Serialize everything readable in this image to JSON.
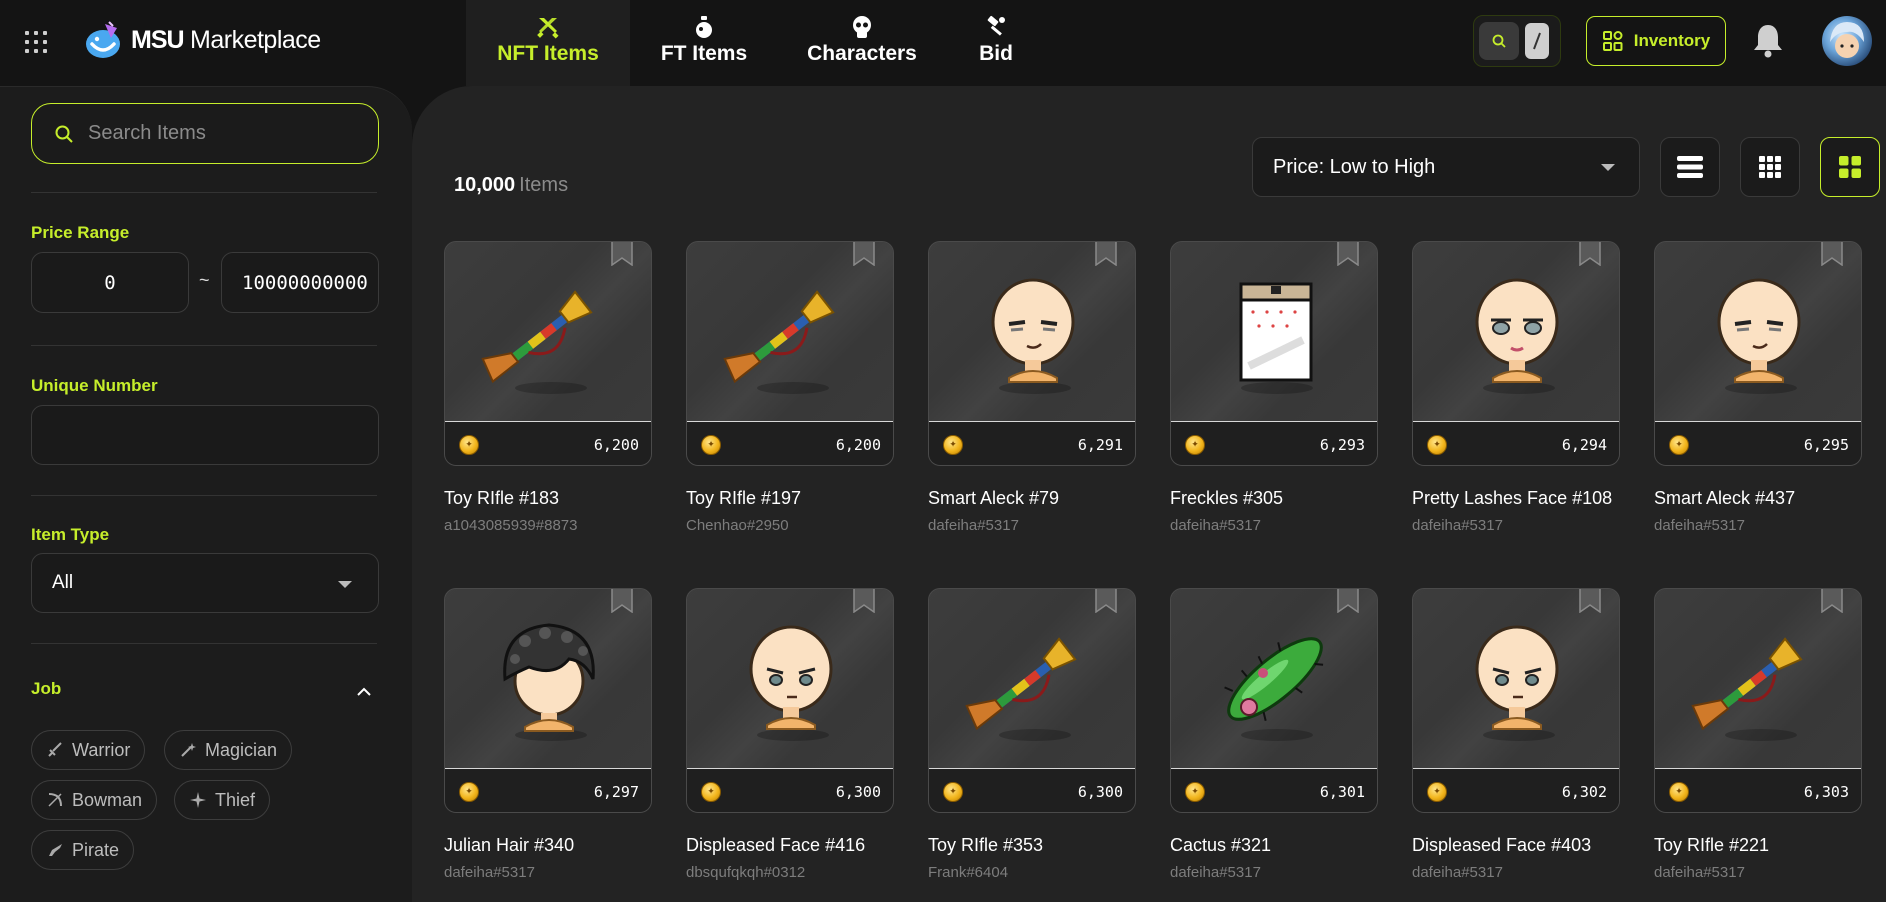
{
  "app": {
    "brand_bold": "MSU",
    "brand_rest": " Marketplace"
  },
  "nav": {
    "tabs": [
      {
        "label": "NFT Items",
        "icon": "sword-icon",
        "active": true
      },
      {
        "label": "FT Items",
        "icon": "potion-icon",
        "active": false
      },
      {
        "label": "Characters",
        "icon": "skull-icon",
        "active": false
      },
      {
        "label": "Bid",
        "icon": "gavel-icon",
        "active": false
      }
    ]
  },
  "header": {
    "inventory_label": "Inventory"
  },
  "sidebar": {
    "search_placeholder": "Search Items",
    "price_range_label": "Price Range",
    "price_min": "0",
    "price_max": "10000000000",
    "price_sep": "~",
    "unique_number_label": "Unique Number",
    "item_type_label": "Item Type",
    "item_type_value": "All",
    "job_label": "Job",
    "jobs": [
      "Warrior",
      "Magician",
      "Bowman",
      "Thief",
      "Pirate"
    ]
  },
  "main": {
    "count": "10,000",
    "count_label": "Items",
    "sort_value": "Price: Low to High"
  },
  "colors": {
    "accent": "#c6ee2b",
    "bg": "#141414",
    "panel": "#1c1c1c"
  },
  "items": [
    {
      "name": "Toy RIfle #183",
      "owner": "a1043085939#8873",
      "price": "6,200",
      "sprite": "rifle"
    },
    {
      "name": "Toy RIfle #197",
      "owner": "Chenhao#2950",
      "price": "6,200",
      "sprite": "rifle"
    },
    {
      "name": "Smart Aleck #79",
      "owner": "dafeiha#5317",
      "price": "6,291",
      "sprite": "face-smirk"
    },
    {
      "name": "Freckles #305",
      "owner": "dafeiha#5317",
      "price": "6,293",
      "sprite": "scroll"
    },
    {
      "name": "Pretty Lashes Face #108",
      "owner": "dafeiha#5317",
      "price": "6,294",
      "sprite": "face-lashes"
    },
    {
      "name": "Smart Aleck #437",
      "owner": "dafeiha#5317",
      "price": "6,295",
      "sprite": "face-smirk"
    },
    {
      "name": "Julian Hair #340",
      "owner": "dafeiha#5317",
      "price": "6,297",
      "sprite": "hair"
    },
    {
      "name": "Displeased Face #416",
      "owner": "dbsqufqkqh#0312",
      "price": "6,300",
      "sprite": "face-displeased"
    },
    {
      "name": "Toy RIfle #353",
      "owner": "Frank#6404",
      "price": "6,300",
      "sprite": "rifle"
    },
    {
      "name": "Cactus #321",
      "owner": "dafeiha#5317",
      "price": "6,301",
      "sprite": "cactus"
    },
    {
      "name": "Displeased Face #403",
      "owner": "dafeiha#5317",
      "price": "6,302",
      "sprite": "face-displeased"
    },
    {
      "name": "Toy RIfle #221",
      "owner": "dafeiha#5317",
      "price": "6,303",
      "sprite": "rifle"
    }
  ]
}
